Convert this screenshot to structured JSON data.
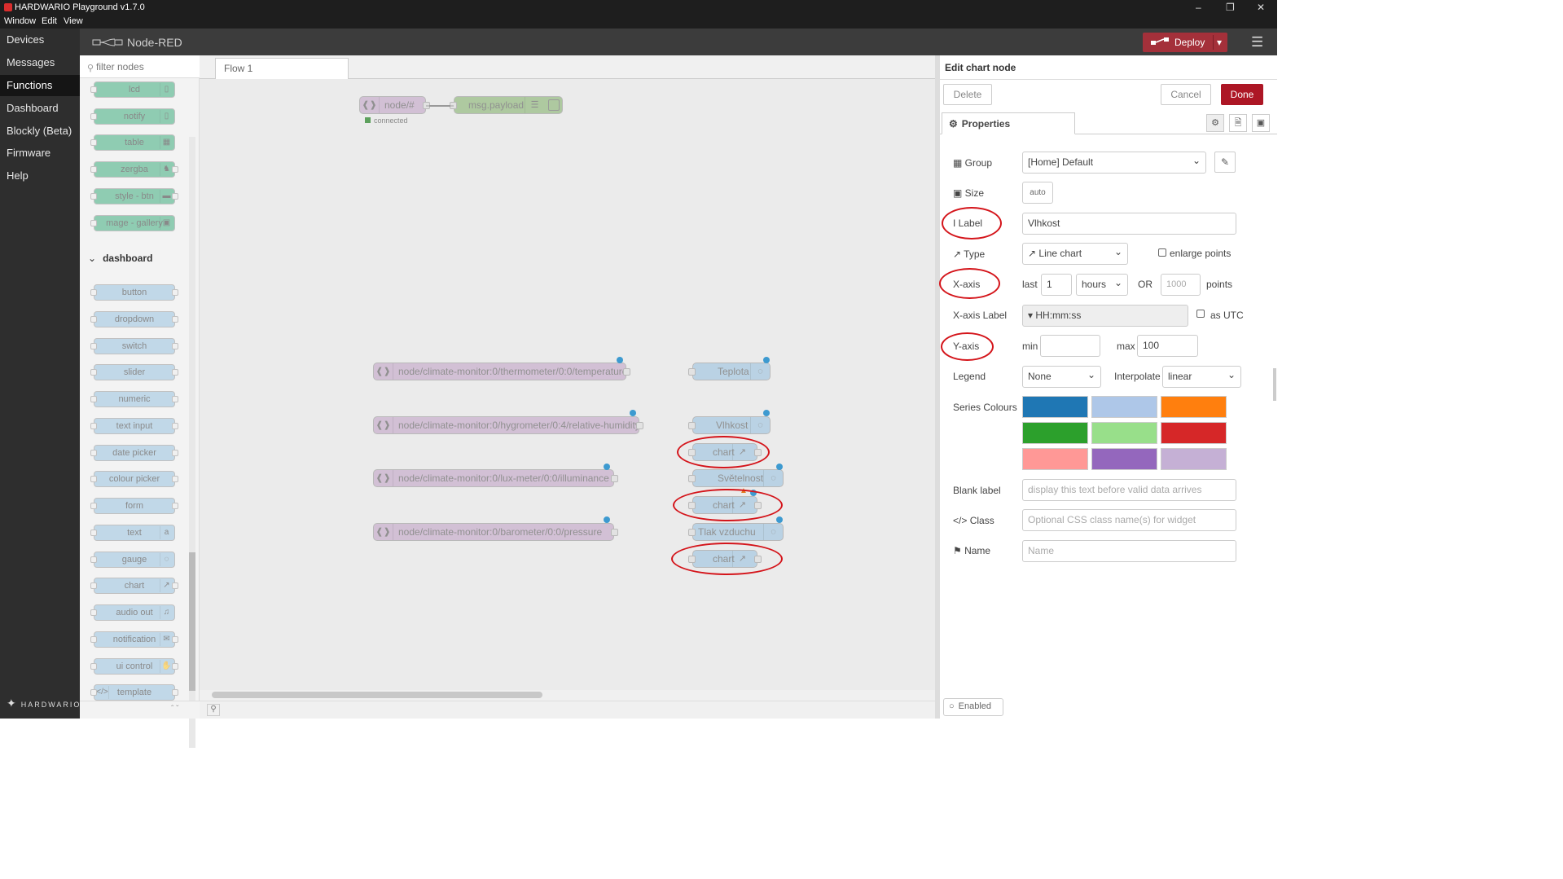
{
  "window": {
    "title": "HARDWARIO Playground v1.7.0",
    "menu": [
      "Window",
      "Edit",
      "View"
    ]
  },
  "nav": {
    "items": [
      "Devices",
      "Messages",
      "Functions",
      "Dashboard",
      "Blockly (Beta)",
      "Firmware",
      "Help"
    ],
    "active": "Functions",
    "logo": "HARDWARIO"
  },
  "nodered": {
    "title": "Node-RED",
    "deploy_label": "Deploy"
  },
  "palette": {
    "filter_placeholder": "filter nodes",
    "top_nodes": [
      "lcd",
      "notify",
      "table",
      "zergba",
      "style - btn",
      "mage - gallery"
    ],
    "category": "dashboard",
    "dashboard_nodes": [
      "button",
      "dropdown",
      "switch",
      "slider",
      "numeric",
      "text input",
      "date picker",
      "colour picker",
      "form",
      "text",
      "gauge",
      "chart",
      "audio out",
      "notification",
      "ui control",
      "template"
    ]
  },
  "flow": {
    "tab": "Flow 1",
    "mqtt_in": "node/#",
    "mqtt_in_status": "connected",
    "debug": "msg.payload",
    "topics": [
      "node/climate-monitor:0/thermometer/0:0/temperature",
      "node/climate-monitor:0/hygrometer/0:4/relative-humidity",
      "node/climate-monitor:0/lux-meter/0:0/illuminance",
      "node/climate-monitor:0/barometer/0:0/pressure"
    ],
    "gauges": [
      "Teplota",
      "Vlhkost",
      "Světelnost",
      "Tlak vzduchu"
    ],
    "chart_label": "chart"
  },
  "editor": {
    "title": "Edit chart node",
    "delete": "Delete",
    "cancel": "Cancel",
    "done": "Done",
    "tab": "Properties",
    "group_label": "Group",
    "group_value": "[Home] Default",
    "size_label": "Size",
    "size_value": "auto",
    "label_label": "Label",
    "label_value": "Vlhkost",
    "type_label": "Type",
    "type_value": "Line chart",
    "enlarge_points": "enlarge points",
    "xaxis_label": "X-axis",
    "last": "last",
    "last_value": "1",
    "unit_value": "hours",
    "or": "OR",
    "points_placeholder": "1000",
    "points": "points",
    "xaxis_label_label": "X-axis Label",
    "xaxis_format": "HH:mm:ss",
    "as_utc": "as UTC",
    "yaxis_label": "Y-axis",
    "min": "min",
    "min_value": "",
    "max": "max",
    "max_value": "100",
    "legend_label": "Legend",
    "legend_value": "None",
    "interpolate_label": "Interpolate",
    "interpolate_value": "linear",
    "series_colours_label": "Series Colours",
    "series_colours": [
      "#1f77b4",
      "#aec7e8",
      "#ff7f0e",
      "#2ca02c",
      "#98df8a",
      "#d62728",
      "#ff9896",
      "#9467bd",
      "#c5b0d5"
    ],
    "blank_label_label": "Blank label",
    "blank_label_placeholder": "display this text before valid data arrives",
    "class_label": "Class",
    "class_placeholder": "Optional CSS class name(s) for widget",
    "name_label": "Name",
    "name_placeholder": "Name",
    "enabled": "Enabled"
  },
  "colors": {
    "deploy": "#a4303a",
    "done": "#ad1625",
    "annotation": "#d4141a"
  }
}
